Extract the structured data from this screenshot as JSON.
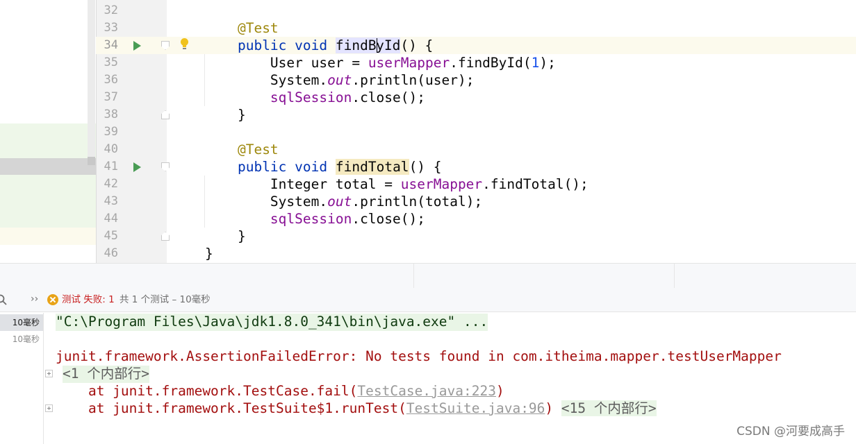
{
  "editor": {
    "lines": [
      {
        "n": "32"
      },
      {
        "n": "33",
        "annotation": "@Test"
      },
      {
        "n": "34",
        "kw1": "public",
        "kw2": "void",
        "name_pre": "findB",
        "name_post": "yId",
        "tail": "() {"
      },
      {
        "n": "35",
        "type": "User user = ",
        "field": "userMapper",
        "call": ".findById(",
        "arg": "1",
        "end": ");"
      },
      {
        "n": "36",
        "pre": "System.",
        "stat": "out",
        "post": ".println(user);"
      },
      {
        "n": "37",
        "field": "sqlSession",
        "post": ".close();"
      },
      {
        "n": "38",
        "text": "}"
      },
      {
        "n": "39"
      },
      {
        "n": "40",
        "annotation": "@Test"
      },
      {
        "n": "41",
        "kw1": "public",
        "kw2": "void",
        "name": "findTotal",
        "tail": "() {"
      },
      {
        "n": "42",
        "type": "Integer total = ",
        "field": "userMapper",
        "call": ".findTotal();"
      },
      {
        "n": "43",
        "pre": "System.",
        "stat": "out",
        "post": ".println(total);"
      },
      {
        "n": "44",
        "field": "sqlSession",
        "post": ".close();"
      },
      {
        "n": "45",
        "text": "}"
      },
      {
        "n": "46",
        "text": "}"
      }
    ]
  },
  "status": {
    "label_test": "测试",
    "label_failed": "失败:",
    "failed_count": "1",
    "detail": "共 1 个测试 – 10毫秒"
  },
  "run_tree": {
    "rows": [
      "10毫秒",
      "10毫秒"
    ]
  },
  "console": {
    "command": "\"C:\\Program Files\\Java\\jdk1.8.0_341\\bin\\java.exe\" ...",
    "error": "junit.framework.AssertionFailedError: No tests found in com.itheima.mapper.testUserMapper",
    "internal_1": "<1 个内部行>",
    "trace_1_pre": "    at junit.framework.TestCase.fail(",
    "trace_1_link": "TestCase.java:223",
    "trace_1_post": ")",
    "trace_2_pre": "    at junit.framework.TestSuite$1.runTest(",
    "trace_2_link": "TestSuite.java:96",
    "trace_2_post": ")",
    "internal_2": "<15 个内部行>"
  },
  "watermark": "CSDN @河要成高手",
  "colors": {
    "keyword": "#0033b3",
    "annotation": "#9e880d",
    "field": "#871094",
    "number": "#1750eb",
    "error_text": "#a30f0f",
    "run_green": "#499c54",
    "fail_orange": "#e8a317"
  },
  "icons": [
    "run-test-icon",
    "fold-icon",
    "intention-bulb-icon",
    "search-icon",
    "expand-icon",
    "test-failed-icon",
    "fold-lines-icon"
  ]
}
